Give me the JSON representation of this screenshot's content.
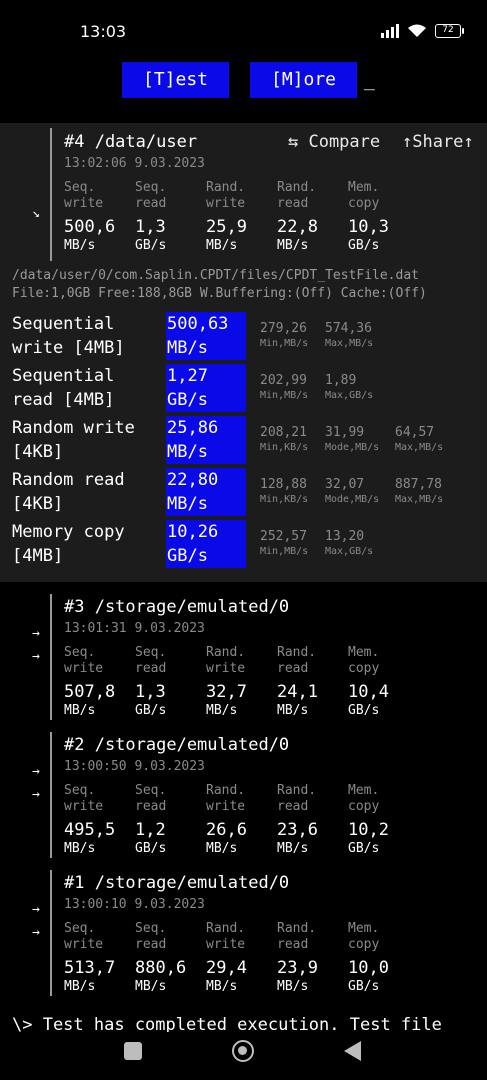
{
  "status_bar": {
    "time": "13:03",
    "battery": "72"
  },
  "toolbar": {
    "test_label": "[T]est",
    "more_label": "[M]ore",
    "cursor": "_"
  },
  "current": {
    "title": "#4 /data/user",
    "date": "13:02:06 9.03.2023",
    "compare_label": "⇆ Compare",
    "share_label": "↑Share↑",
    "arrow": "↘",
    "metrics": [
      {
        "l1": "Seq.",
        "l2": "write",
        "value": "500,6",
        "unit": "MB/s"
      },
      {
        "l1": "Seq.",
        "l2": "read",
        "value": "1,3",
        "unit": "GB/s"
      },
      {
        "l1": "Rand.",
        "l2": "write",
        "value": "25,9",
        "unit": "MB/s"
      },
      {
        "l1": "Rand.",
        "l2": "read",
        "value": "22,8",
        "unit": "MB/s"
      },
      {
        "l1": "Mem.",
        "l2": "copy",
        "value": "10,3",
        "unit": "GB/s"
      }
    ]
  },
  "file_info": {
    "path": "/data/user/0/com.Saplin.CPDT/files/CPDT_TestFile.dat",
    "details": "File:1,0GB Free:188,8GB W.Buffering:(Off) Cache:(Off)"
  },
  "details": [
    {
      "l1": "Sequential",
      "l2": "write [4MB]",
      "v1": "500,63",
      "v2": "MB/s",
      "stats": [
        {
          "n": "279,26",
          "u": "Min,MB/s"
        },
        {
          "n": "574,36",
          "u": "Max,MB/s"
        }
      ]
    },
    {
      "l1": "Sequential",
      "l2": "read [4MB]",
      "v1": "1,27",
      "v2": "GB/s",
      "stats": [
        {
          "n": "202,99",
          "u": "Min,MB/s"
        },
        {
          "n": "1,89",
          "u": "Max,GB/s"
        }
      ]
    },
    {
      "l1": "Random write",
      "l2": "[4KB]",
      "v1": "25,86",
      "v2": "MB/s",
      "stats": [
        {
          "n": "208,21",
          "u": "Min,KB/s"
        },
        {
          "n": "31,99",
          "u": "Mode,MB/s"
        },
        {
          "n": "64,57",
          "u": "Max,MB/s"
        }
      ]
    },
    {
      "l1": "Random read",
      "l2": "[4KB]",
      "v1": "22,80",
      "v2": "MB/s",
      "stats": [
        {
          "n": "128,88",
          "u": "Min,KB/s"
        },
        {
          "n": "32,07",
          "u": "Mode,MB/s"
        },
        {
          "n": "887,78",
          "u": "Max,MB/s"
        }
      ]
    },
    {
      "l1": "Memory copy",
      "l2": "[4MB]",
      "v1": "10,26",
      "v2": "GB/s",
      "stats": [
        {
          "n": "252,57",
          "u": "Min,MB/s"
        },
        {
          "n": "13,20",
          "u": "Max,GB/s"
        }
      ]
    }
  ],
  "history": [
    {
      "title": "#3 /storage/emulated/0",
      "date": "13:01:31 9.03.2023",
      "metrics": [
        {
          "l1": "Seq.",
          "l2": "write",
          "value": "507,8",
          "unit": "MB/s"
        },
        {
          "l1": "Seq.",
          "l2": "read",
          "value": "1,3",
          "unit": "GB/s"
        },
        {
          "l1": "Rand.",
          "l2": "write",
          "value": "32,7",
          "unit": "MB/s"
        },
        {
          "l1": "Rand.",
          "l2": "read",
          "value": "24,1",
          "unit": "MB/s"
        },
        {
          "l1": "Mem.",
          "l2": "copy",
          "value": "10,4",
          "unit": "GB/s"
        }
      ]
    },
    {
      "title": "#2 /storage/emulated/0",
      "date": "13:00:50 9.03.2023",
      "metrics": [
        {
          "l1": "Seq.",
          "l2": "write",
          "value": "495,5",
          "unit": "MB/s"
        },
        {
          "l1": "Seq.",
          "l2": "read",
          "value": "1,2",
          "unit": "GB/s"
        },
        {
          "l1": "Rand.",
          "l2": "write",
          "value": "26,6",
          "unit": "MB/s"
        },
        {
          "l1": "Rand.",
          "l2": "read",
          "value": "23,6",
          "unit": "MB/s"
        },
        {
          "l1": "Mem.",
          "l2": "copy",
          "value": "10,2",
          "unit": "GB/s"
        }
      ]
    },
    {
      "title": "#1 /storage/emulated/0",
      "date": "13:00:10 9.03.2023",
      "metrics": [
        {
          "l1": "Seq.",
          "l2": "write",
          "value": "513,7",
          "unit": "MB/s"
        },
        {
          "l1": "Seq.",
          "l2": "read",
          "value": "880,6",
          "unit": "MB/s"
        },
        {
          "l1": "Rand.",
          "l2": "write",
          "value": "29,4",
          "unit": "MB/s"
        },
        {
          "l1": "Rand.",
          "l2": "read",
          "value": "23,9",
          "unit": "MB/s"
        },
        {
          "l1": "Mem.",
          "l2": "copy",
          "value": "10,0",
          "unit": "GB/s"
        }
      ]
    }
  ],
  "history_arrow": "→",
  "footer": "\\> Test has completed execution. Test file"
}
